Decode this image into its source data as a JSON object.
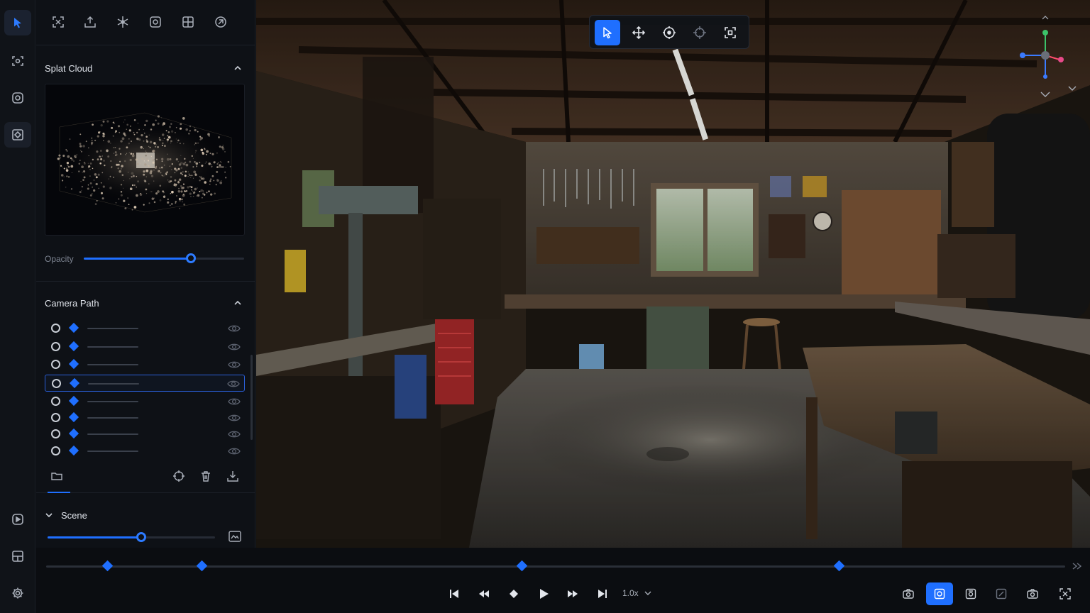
{
  "sidebar": {
    "rail_icons": [
      "pointer-icon",
      "capture-icon",
      "orbit-icon",
      "splat-icon",
      "record-icon",
      "layout-icon",
      "settings-icon"
    ],
    "tool_icons": [
      "frame-icon",
      "export-icon",
      "splat-tool-icon",
      "camera-box-icon",
      "grid-icon",
      "link-icon"
    ]
  },
  "splat_cloud": {
    "title": "Splat Cloud",
    "opacity_label": "Opacity",
    "opacity_value": 0.67
  },
  "camera_path": {
    "title": "Camera Path",
    "rows": [
      {
        "selected": false
      },
      {
        "selected": false
      },
      {
        "selected": false
      },
      {
        "selected": true
      },
      {
        "selected": false
      },
      {
        "selected": false
      },
      {
        "selected": false
      },
      {
        "selected": false
      }
    ],
    "actions": [
      "folder-icon",
      "crosshair-icon",
      "trash-icon",
      "download-icon"
    ]
  },
  "scene": {
    "title": "Scene",
    "slider_value": 0.56
  },
  "viewport": {
    "toolbar": [
      "select-icon",
      "move-icon",
      "target-icon",
      "pan-icon",
      "fit-icon"
    ],
    "active_tool": "select-icon"
  },
  "timeline": {
    "keyframes": [
      0.06,
      0.153,
      0.467,
      0.778
    ],
    "speed_label": "1.0x",
    "right_tools": [
      "snapshot-icon",
      "render-icon",
      "camera-frame-icon",
      "crop-icon",
      "photo-icon",
      "fullscreen-icon"
    ],
    "active_right_tool": "render-icon"
  },
  "colors": {
    "accent": "#1f6fff",
    "panel": "#0e1116",
    "rail": "#101318"
  }
}
